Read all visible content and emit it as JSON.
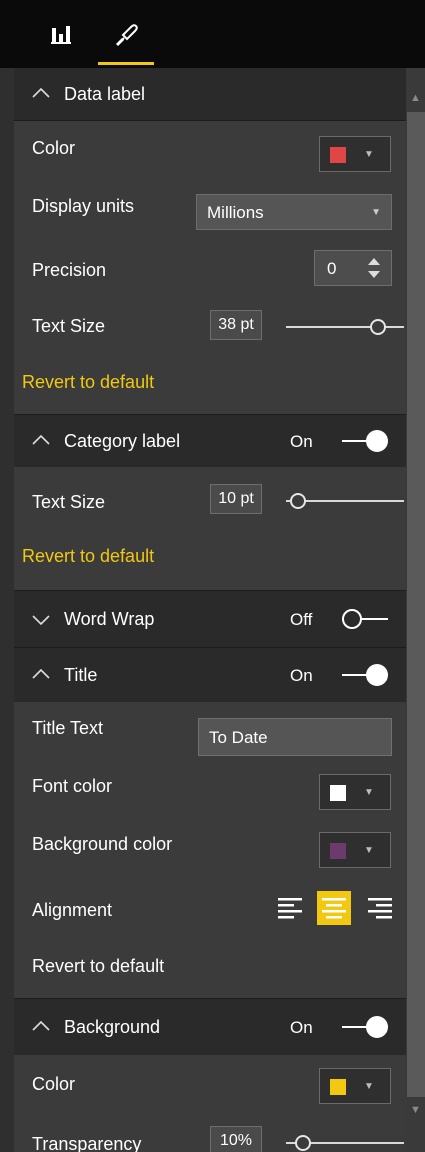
{
  "tabs": {
    "fields_icon": "bar-chart-icon",
    "format_icon": "paint-roller-icon"
  },
  "colors": {
    "accent": "#f2c811",
    "data_label_color": "#e04646",
    "font_color": "#ffffff",
    "background_color": "#6d3a6d",
    "bg_section_color": "#f2c811"
  },
  "data_label": {
    "header": "Data label",
    "color_label": "Color",
    "display_units_label": "Display units",
    "display_units_value": "Millions",
    "precision_label": "Precision",
    "precision_value": "0",
    "text_size_label": "Text Size",
    "text_size_value": "38 pt",
    "text_size_level": 0.85,
    "revert": "Revert to default"
  },
  "category_label": {
    "header": "Category label",
    "toggle": "On",
    "text_size_label": "Text Size",
    "text_size_value": "10 pt",
    "text_size_level": 0.08,
    "revert": "Revert to default"
  },
  "word_wrap": {
    "header": "Word Wrap",
    "toggle": "Off"
  },
  "title": {
    "header": "Title",
    "toggle": "On",
    "title_text_label": "Title Text",
    "title_text_value": "To Date",
    "font_color_label": "Font color",
    "background_color_label": "Background color",
    "alignment_label": "Alignment",
    "alignment_selected": "center",
    "revert": "Revert to default"
  },
  "background": {
    "header": "Background",
    "toggle": "On",
    "color_label": "Color",
    "transparency_label": "Transparency",
    "transparency_value": "10%",
    "transparency_level": 0.1
  }
}
